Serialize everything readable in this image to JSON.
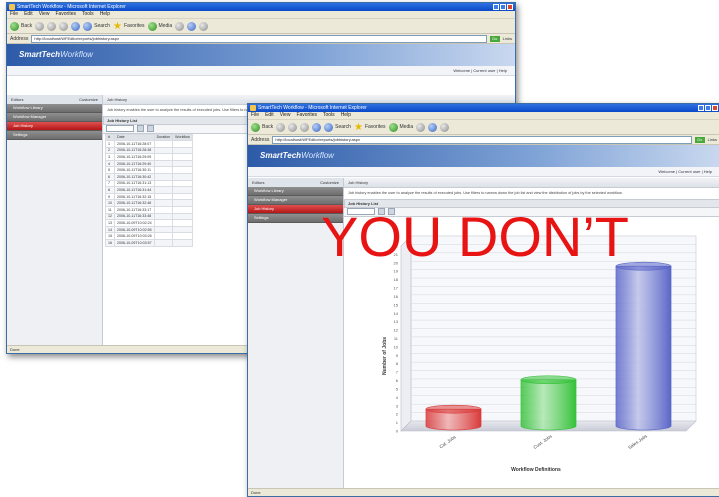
{
  "overlay": {
    "text": "YOU DON’T"
  },
  "browser": {
    "title": "SmartTech Workflow - Microsoft Internet Explorer",
    "menu": [
      "File",
      "Edit",
      "View",
      "Favorites",
      "Tools",
      "Help"
    ],
    "toolbar": {
      "back": "Back",
      "search": "Search",
      "favorites": "Favorites",
      "media": "Media"
    },
    "address_label": "Address",
    "address": "http://localhost/WFEditor/reports/jobhistory.aspx",
    "go": "Go",
    "links": "Links",
    "status": "Done"
  },
  "app": {
    "logo_a": "SmartTech",
    "logo_b": "Workflow",
    "user_info": "Welcome | Current user | Help",
    "sidebar_head": {
      "label": "Editors",
      "action": "Customize"
    },
    "sidebar_items": [
      {
        "label": "Workflow Library",
        "active": false
      },
      {
        "label": "Workflow Manager",
        "active": false
      },
      {
        "label": "Job History",
        "active": true
      },
      {
        "label": "Settings",
        "active": false
      }
    ],
    "page_title": "Job History",
    "description": "Job history enables the user to analyze the results of executed jobs. Use filters to narrow down the job list and view the distribution of jobs by the selected workflow.",
    "panel_title": "Job History List",
    "table": {
      "headers": [
        "#",
        "Date",
        "Duration",
        "Workflow"
      ],
      "rows": [
        [
          "1",
          "2006-10-11T16:28:07",
          "",
          ""
        ],
        [
          "2",
          "2006-10-11T16:28:38",
          "",
          ""
        ],
        [
          "3",
          "2006-10-11T16:29:09",
          "",
          ""
        ],
        [
          "4",
          "2006-10-11T16:29:40",
          "",
          ""
        ],
        [
          "5",
          "2006-10-11T16:30:11",
          "",
          ""
        ],
        [
          "6",
          "2006-10-11T16:30:42",
          "",
          ""
        ],
        [
          "7",
          "2006-10-11T16:31:13",
          "",
          ""
        ],
        [
          "8",
          "2006-10-11T16:31:44",
          "",
          ""
        ],
        [
          "9",
          "2006-10-11T16:32:15",
          "",
          ""
        ],
        [
          "10",
          "2006-10-11T16:32:46",
          "",
          ""
        ],
        [
          "11",
          "2006-10-11T16:33:17",
          "",
          ""
        ],
        [
          "12",
          "2006-10-11T16:33:48",
          "",
          ""
        ],
        [
          "13",
          "2006-10-09T10:02:24",
          "",
          ""
        ],
        [
          "14",
          "2006-10-09T10:02:55",
          "",
          ""
        ],
        [
          "15",
          "2006-10-09T10:03:26",
          "",
          ""
        ],
        [
          "16",
          "2006-10-09T10:03:57",
          "",
          ""
        ]
      ]
    }
  },
  "chart_data": {
    "type": "bar",
    "categories": [
      "Cat. Jobs",
      "Cust. Jobs",
      "Sales Jobs"
    ],
    "values": [
      2,
      5.5,
      19
    ],
    "ylim": [
      0,
      22
    ],
    "ylabel": "Number of Jobs",
    "xlabel": "Workflow Definitions",
    "colors": [
      "#d93a3a",
      "#36c23a",
      "#5b66c8"
    ],
    "grid": true
  }
}
